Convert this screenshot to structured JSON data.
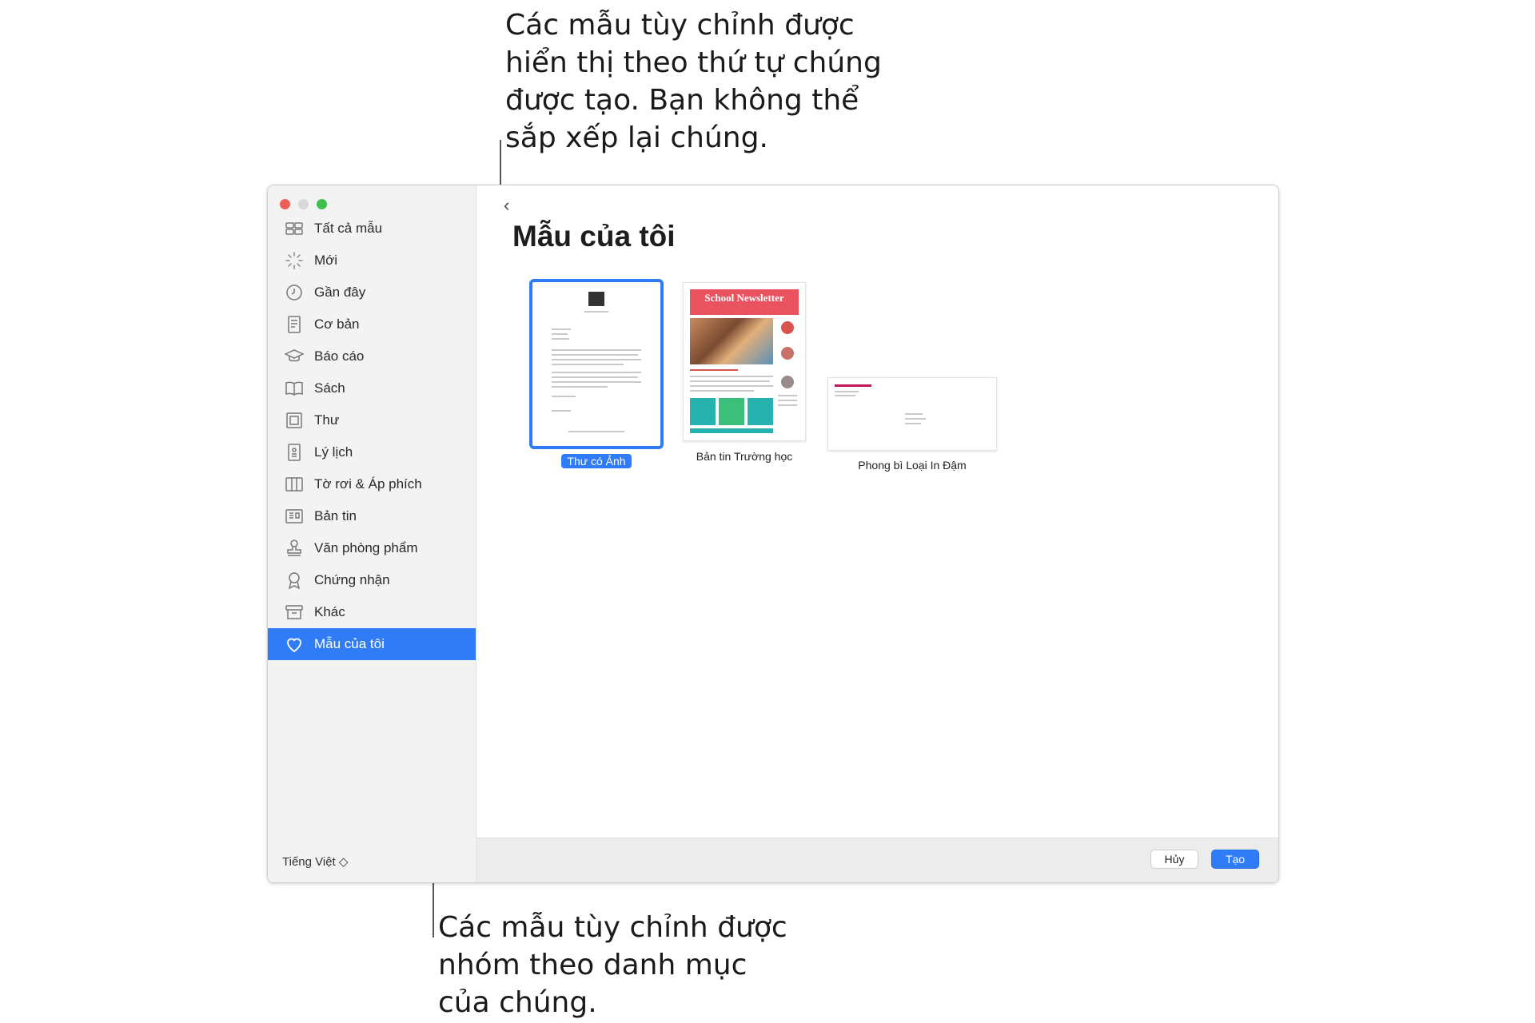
{
  "callouts": {
    "top": "Các mẫu tùy chỉnh được\nhiển thị theo thứ tự chúng\nđược tạo. Bạn không thể\nsắp xếp lại chúng.",
    "bottom": "Các mẫu tùy chỉnh được\nnhóm theo danh mục\ncủa chúng."
  },
  "sidebar": {
    "items": [
      {
        "label": "Tất cả mẫu",
        "icon": "grid-icon"
      },
      {
        "label": "Mới",
        "icon": "sparkle-icon"
      },
      {
        "label": "Gần đây",
        "icon": "clock-icon"
      },
      {
        "label": "Cơ bản",
        "icon": "document-icon"
      },
      {
        "label": "Báo cáo",
        "icon": "graduation-cap-icon"
      },
      {
        "label": "Sách",
        "icon": "book-icon"
      },
      {
        "label": "Thư",
        "icon": "letter-icon"
      },
      {
        "label": "Lý lịch",
        "icon": "resume-icon"
      },
      {
        "label": "Tờ rơi & Áp phích",
        "icon": "flyer-icon"
      },
      {
        "label": "Bản tin",
        "icon": "newsletter-icon"
      },
      {
        "label": "Văn phòng phẩm",
        "icon": "stamp-icon"
      },
      {
        "label": "Chứng nhận",
        "icon": "ribbon-icon"
      },
      {
        "label": "Khác",
        "icon": "archive-box-icon"
      },
      {
        "label": "Mẫu của tôi",
        "icon": "heart-icon",
        "selected": true
      }
    ],
    "language": "Tiếng Việt ◇"
  },
  "main": {
    "back": "‹",
    "title": "Mẫu của tôi",
    "templates": [
      {
        "label": "Thư có Ảnh",
        "selected": true
      },
      {
        "label": "Bản tin Trường học"
      },
      {
        "label": "Phong bì Loại In Đậm"
      }
    ],
    "newsletter_heading": "School Newsletter"
  },
  "footer": {
    "cancel": "Hủy",
    "create": "Tạo"
  },
  "colors": {
    "accent": "#2f7cf6",
    "sidebar_bg": "#f3f3f3",
    "newsletter_red": "#e8535f",
    "newsletter_teal": "#27b2b0"
  }
}
